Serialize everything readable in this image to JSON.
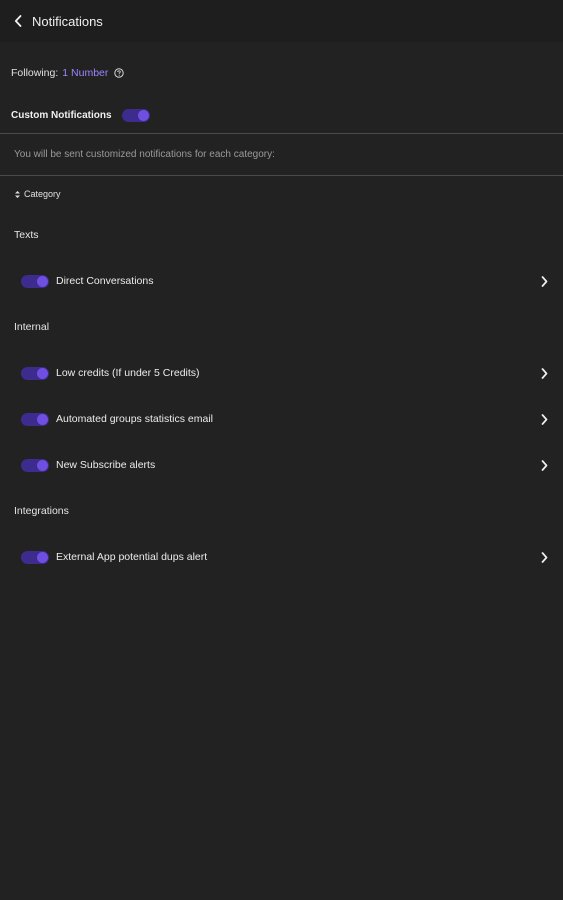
{
  "header": {
    "title": "Notifications",
    "back_icon": "chevron-left-icon"
  },
  "following": {
    "label": "Following:",
    "link": "1 Number",
    "help_icon": "question-circle-icon"
  },
  "custom": {
    "label": "Custom Notifications",
    "enabled": true
  },
  "description": "You will be sent customized notifications for each category:",
  "category_sort": {
    "label": "Category",
    "icon": "sort-icon"
  },
  "sections": [
    {
      "title": "Texts",
      "items": [
        {
          "label": "Direct Conversations",
          "enabled": true
        }
      ]
    },
    {
      "title": "Internal",
      "items": [
        {
          "label": "Low credits (If under 5 Credits)",
          "enabled": true
        },
        {
          "label": "Automated groups statistics email",
          "enabled": true
        },
        {
          "label": "New Subscribe alerts",
          "enabled": true
        }
      ]
    },
    {
      "title": "Integrations",
      "items": [
        {
          "label": "External App potential dups alert",
          "enabled": true
        }
      ]
    }
  ],
  "colors": {
    "background": "#222222",
    "header": "#1e1e1e",
    "accent": "#9c84ff",
    "toggle_track": "#3d2c8d",
    "toggle_knob": "#6f4fe0"
  }
}
